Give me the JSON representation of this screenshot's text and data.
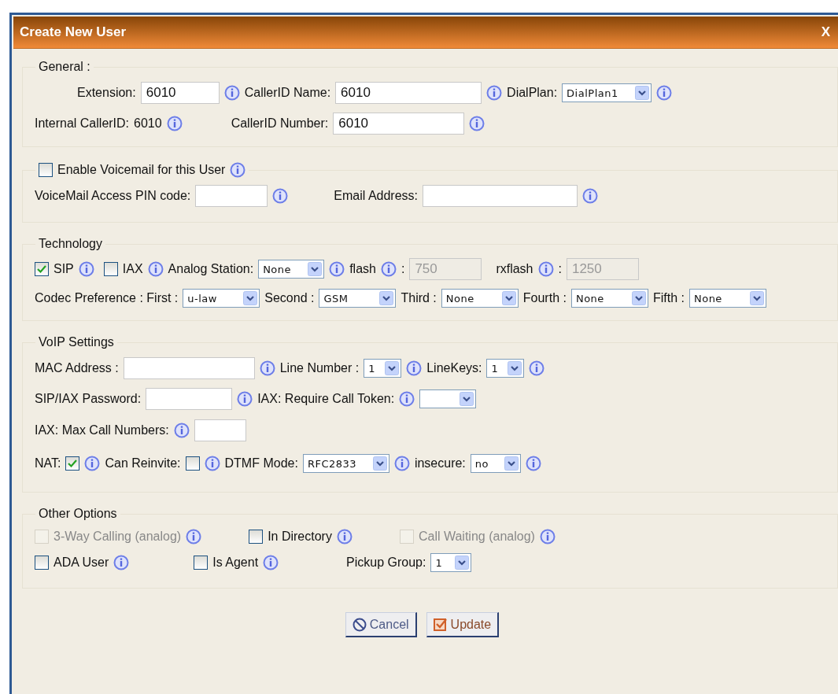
{
  "dialog": {
    "title": "Create New User",
    "close": "X"
  },
  "sections": [
    {
      "legend": {
        "kind": "label",
        "text": "General :"
      },
      "rows": [
        {
          "items": [
            {
              "kind": "label",
              "text": "Extension:"
            },
            {
              "kind": "input",
              "value": "6010"
            },
            {
              "kind": "info"
            },
            {
              "kind": "label",
              "text": "CallerID Name:"
            },
            {
              "kind": "input",
              "value": "6010"
            },
            {
              "kind": "info"
            },
            {
              "kind": "label",
              "text": "DialPlan:"
            },
            {
              "kind": "select",
              "value": "DialPlan1"
            },
            {
              "kind": "info"
            }
          ]
        },
        {
          "items": [
            {
              "kind": "label",
              "text": "Internal CallerID:"
            },
            {
              "kind": "text",
              "text": "6010"
            },
            {
              "kind": "info"
            },
            {
              "kind": "label",
              "text": "CallerID Number:"
            },
            {
              "kind": "input",
              "value": "6010"
            },
            {
              "kind": "info"
            }
          ]
        }
      ]
    },
    {
      "legend": {
        "kind": "checkbox",
        "label": "Enable Voicemail for this User",
        "checked": false
      },
      "legend_info": {
        "kind": "info"
      },
      "rows": [
        {
          "items": [
            {
              "kind": "label",
              "text": "VoiceMail Access PIN code:"
            },
            {
              "kind": "input"
            },
            {
              "kind": "info"
            },
            {
              "kind": "label",
              "text": "Email Address:"
            },
            {
              "kind": "input"
            },
            {
              "kind": "info"
            }
          ]
        }
      ]
    },
    {
      "legend": {
        "kind": "label",
        "text": "Technology"
      },
      "rows": [
        {
          "items": [
            {
              "kind": "checkbox",
              "label": "SIP",
              "checked": true
            },
            {
              "kind": "info"
            },
            {
              "kind": "checkbox",
              "label": "IAX",
              "checked": false
            },
            {
              "kind": "info"
            },
            {
              "kind": "label",
              "text": "Analog Station:"
            },
            {
              "kind": "select",
              "value": "None"
            },
            {
              "kind": "info"
            },
            {
              "kind": "label",
              "text": "flash"
            },
            {
              "kind": "info"
            },
            {
              "kind": "label",
              "text": ":"
            },
            {
              "kind": "input",
              "value": "750",
              "disabled": true
            },
            {
              "kind": "label",
              "text": "rxflash"
            },
            {
              "kind": "info"
            },
            {
              "kind": "label",
              "text": ":"
            },
            {
              "kind": "input",
              "value": "1250",
              "disabled": true
            }
          ]
        },
        {
          "items": [
            {
              "kind": "label",
              "text": "Codec Preference : First :"
            },
            {
              "kind": "select",
              "value": "u-law"
            },
            {
              "kind": "label",
              "text": "Second :"
            },
            {
              "kind": "select",
              "value": "GSM"
            },
            {
              "kind": "label",
              "text": "Third :"
            },
            {
              "kind": "select",
              "value": "None"
            },
            {
              "kind": "label",
              "text": "Fourth :"
            },
            {
              "kind": "select",
              "value": "None"
            },
            {
              "kind": "label",
              "text": "Fifth :"
            },
            {
              "kind": "select",
              "value": "None"
            }
          ]
        }
      ]
    },
    {
      "legend": {
        "kind": "label",
        "text": "VoIP Settings"
      },
      "rows": [
        {
          "items": [
            {
              "kind": "label",
              "text": "MAC Address :"
            },
            {
              "kind": "input"
            },
            {
              "kind": "info"
            },
            {
              "kind": "label",
              "text": "Line Number :"
            },
            {
              "kind": "select",
              "value": "1"
            },
            {
              "kind": "info"
            },
            {
              "kind": "label",
              "text": "LineKeys:"
            },
            {
              "kind": "select",
              "value": "1"
            },
            {
              "kind": "info"
            }
          ]
        },
        {
          "items": [
            {
              "kind": "label",
              "text": "SIP/IAX Password:"
            },
            {
              "kind": "input"
            },
            {
              "kind": "info"
            },
            {
              "kind": "label",
              "text": "IAX: Require Call Token:"
            },
            {
              "kind": "info"
            },
            {
              "kind": "select"
            }
          ]
        },
        {
          "items": [
            {
              "kind": "label",
              "text": "IAX: Max Call Numbers:"
            },
            {
              "kind": "info"
            },
            {
              "kind": "input"
            }
          ]
        },
        {
          "items": [
            {
              "kind": "label",
              "text": "NAT:"
            },
            {
              "kind": "checkbox",
              "checked": true
            },
            {
              "kind": "info"
            },
            {
              "kind": "label",
              "text": "Can Reinvite:"
            },
            {
              "kind": "checkbox",
              "checked": false
            },
            {
              "kind": "info"
            },
            {
              "kind": "label",
              "text": "DTMF Mode:"
            },
            {
              "kind": "select",
              "value": "RFC2833"
            },
            {
              "kind": "info"
            },
            {
              "kind": "label",
              "text": "insecure:"
            },
            {
              "kind": "select",
              "value": "no"
            },
            {
              "kind": "info"
            }
          ]
        }
      ]
    },
    {
      "legend": {
        "kind": "label",
        "text": "Other Options"
      },
      "rows": [
        {
          "items": [
            {
              "kind": "checkbox",
              "label": "3-Way Calling (analog)",
              "checked": false,
              "disabled": true
            },
            {
              "kind": "info"
            },
            {
              "kind": "checkbox",
              "label": "In Directory",
              "checked": false
            },
            {
              "kind": "info"
            },
            {
              "kind": "checkbox",
              "label": "Call Waiting (analog)",
              "checked": false,
              "disabled": true
            },
            {
              "kind": "info"
            }
          ]
        },
        {
          "items": [
            {
              "kind": "checkbox",
              "label": "ADA User",
              "checked": false
            },
            {
              "kind": "info"
            },
            {
              "kind": "checkbox",
              "label": "Is Agent",
              "checked": false
            },
            {
              "kind": "info"
            },
            {
              "kind": "label",
              "text": "Pickup Group:"
            },
            {
              "kind": "select",
              "value": "1"
            }
          ]
        }
      ]
    }
  ],
  "buttons": [
    {
      "kind": "cancel",
      "label": "Cancel"
    },
    {
      "kind": "update",
      "label": "Update"
    }
  ]
}
